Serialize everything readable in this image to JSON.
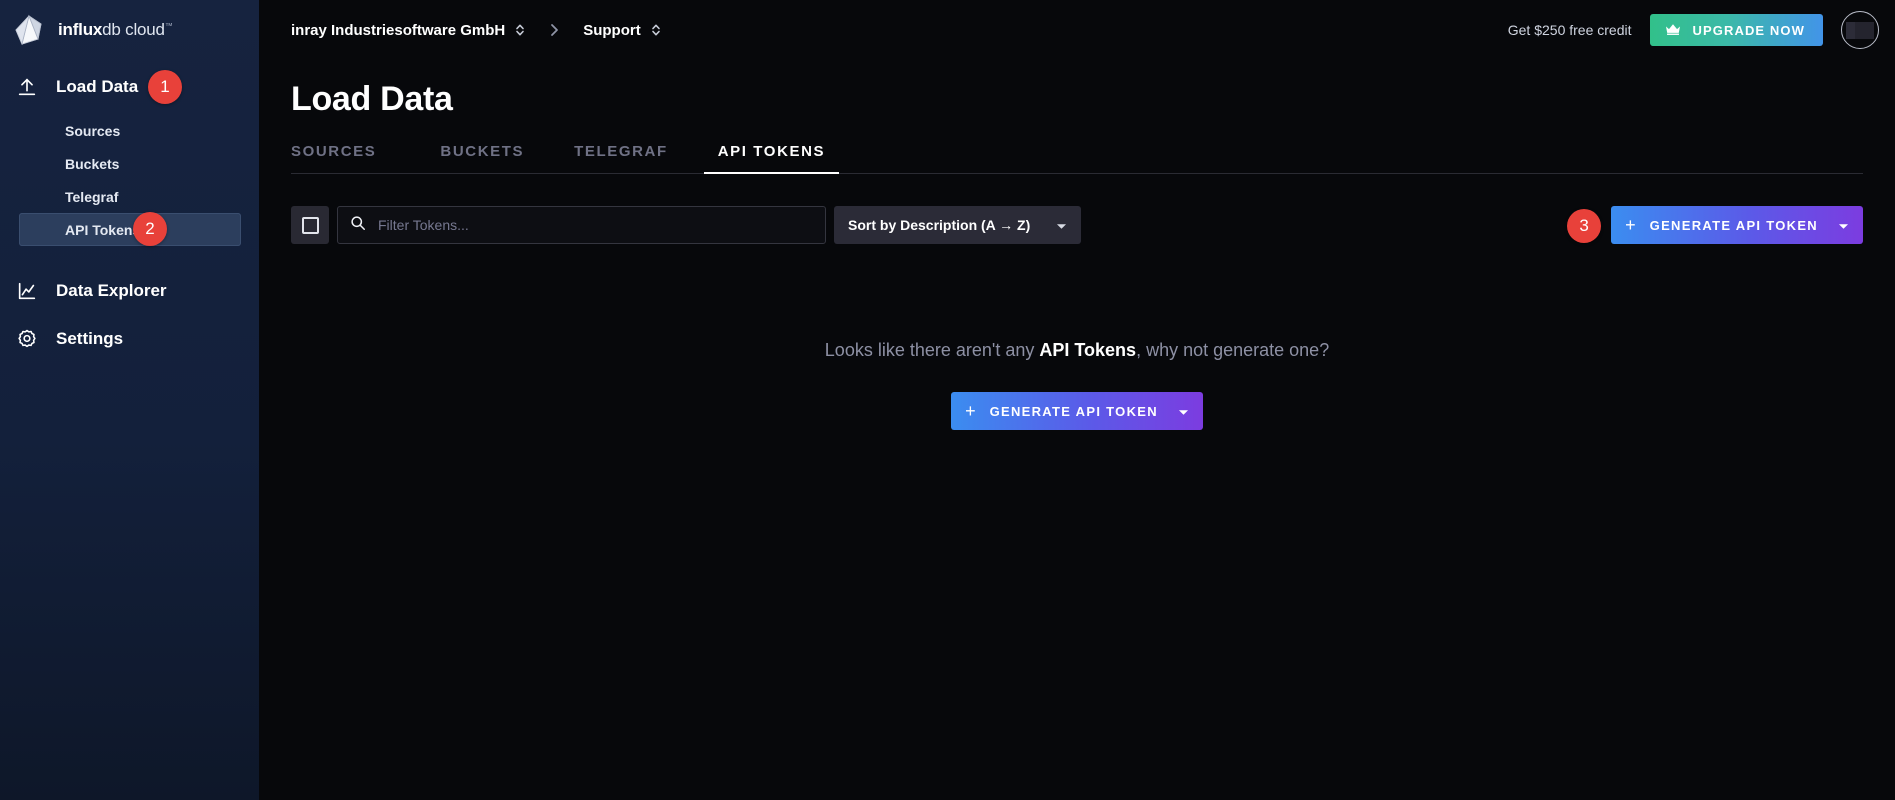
{
  "brand": {
    "name_bold": "influx",
    "name_light": "db cloud",
    "trademark": "™",
    "logo_icon": "influxdb-polyhedron-logo"
  },
  "sidebar": {
    "sections": [
      {
        "label": "Load Data",
        "icon": "upload-icon",
        "badge": "1",
        "items": [
          {
            "label": "Sources",
            "active": false
          },
          {
            "label": "Buckets",
            "active": false
          },
          {
            "label": "Telegraf",
            "active": false
          },
          {
            "label": "API Tokens",
            "active": true,
            "badge": "2"
          }
        ]
      },
      {
        "label": "Data Explorer",
        "icon": "line-chart-icon"
      },
      {
        "label": "Settings",
        "icon": "gear-icon"
      }
    ]
  },
  "topbar": {
    "breadcrumb": {
      "org": "inray Industriesoftware GmbH",
      "separator": "›",
      "project": "Support"
    },
    "free_credit_text": "Get $250 free credit",
    "upgrade_label": "UPGRADE NOW",
    "upgrade_icon": "crown-icon",
    "avatar_name": "user-avatar"
  },
  "main": {
    "page_title": "Load Data",
    "tabs": [
      {
        "label": "SOURCES",
        "active": false
      },
      {
        "label": "BUCKETS",
        "active": false
      },
      {
        "label": "TELEGRAF",
        "active": false
      },
      {
        "label": "API TOKENS",
        "active": true
      }
    ],
    "toolbar": {
      "select_all_icon": "checkbox-square-icon",
      "search_placeholder": "Filter Tokens...",
      "search_value": "",
      "search_icon": "search-icon",
      "sort_label": "Sort by Description (A → Z)",
      "sort_caret_icon": "caret-down-icon",
      "generate_label": "GENERATE API TOKEN",
      "generate_plus": "+",
      "generate_badge": "3"
    },
    "empty_state": {
      "text_before": "Looks like there aren't any ",
      "text_bold": "API Tokens",
      "text_after": ", why not generate one?",
      "generate_label": "GENERATE API TOKEN",
      "generate_plus": "+"
    }
  },
  "colors": {
    "sidebar_bg": "#14213d",
    "sidebar_active": "#2c3e5d",
    "content_bg": "#07080b",
    "badge_red": "#e8413a",
    "gradient_button_start": "#3b8df0",
    "gradient_button_end": "#7c3ce0",
    "upgrade_gradient_start": "#32c08a",
    "upgrade_gradient_end": "#4294e8",
    "muted_text": "#767890"
  }
}
